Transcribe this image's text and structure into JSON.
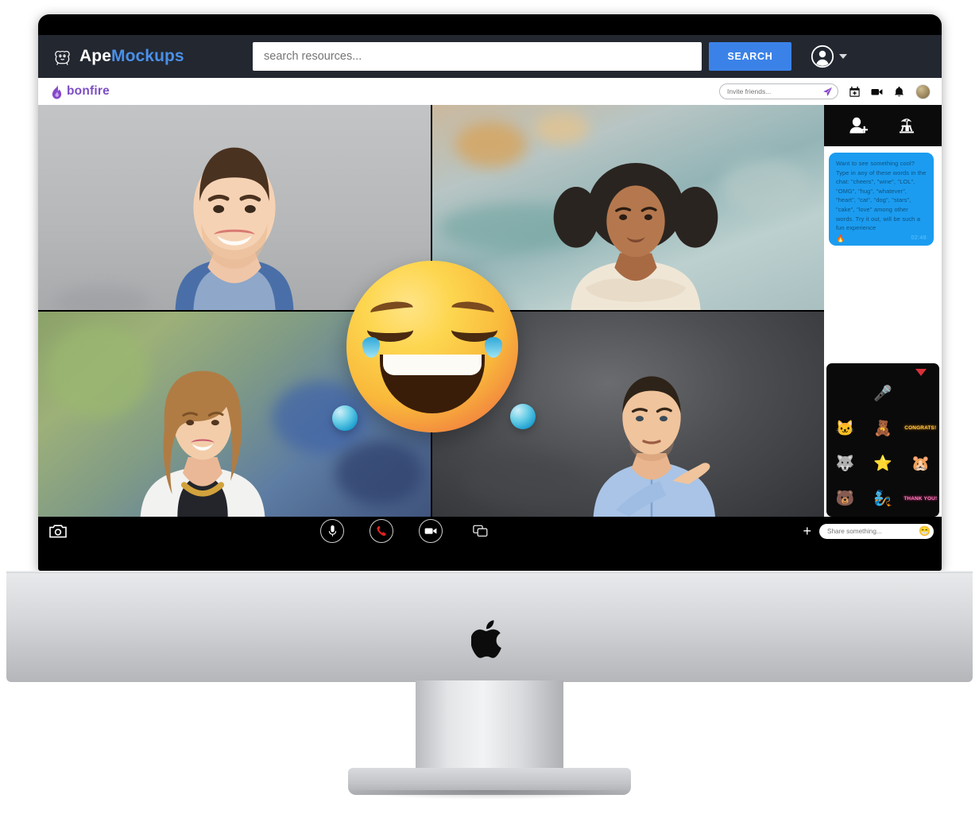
{
  "apebar": {
    "logo_text_a": "Ape",
    "logo_text_b": "Mockups",
    "logo_icon": "gorilla-icon",
    "search_placeholder": "search resources...",
    "search_value": "",
    "search_button": "SEARCH",
    "account_icon": "user-circle-icon",
    "caret_icon": "chevron-down-icon"
  },
  "appbar": {
    "brand": "bonfire",
    "brand_icon": "flame-icon",
    "invite_placeholder": "Invite friends...",
    "invite_value": "",
    "send_icon": "paper-plane-icon",
    "icons": [
      {
        "name": "calendar-add-icon"
      },
      {
        "name": "video-camera-icon"
      },
      {
        "name": "bell-icon"
      }
    ],
    "avatar": "user-avatar"
  },
  "video_grid": {
    "tiles": [
      {
        "name": "participant-tile-1",
        "description": "smiling bearded man in plaid shirt on gray backdrop"
      },
      {
        "name": "participant-tile-2",
        "description": "woman with curly hair in cream blouse, arms crossed"
      },
      {
        "name": "participant-tile-3",
        "description": "woman with long light brown hair and white blazer"
      },
      {
        "name": "participant-tile-4",
        "description": "man in light blue shirt making a shrug gesture"
      }
    ]
  },
  "emoji_overlay": {
    "name": "laughing-emoji-reaction",
    "glyph": "face-with-tears-of-joy"
  },
  "sidebar": {
    "actions": [
      {
        "name": "add-person-icon"
      },
      {
        "name": "beach-scene-icon"
      }
    ],
    "messages": [
      {
        "text": "Want to see something cool? Type in any of these words in the chat: \"cheers\", \"wine\", \"LOL\", \"OMG\", \"hug\", \"whatever\", \"heart\", \"cat\", \"dog\", \"stars\", \"cake\", \"love\" among other words. Try it out, will be such a fun experience",
        "emoji": "🔥",
        "time": "02:48"
      }
    ],
    "sticker_panel": {
      "caret_icon": "caret-down-icon",
      "stickers": [
        {
          "glyph": "🎤",
          "label": "microphone-sticker"
        },
        {
          "glyph": "🐱",
          "label": "cat-hello-sticker"
        },
        {
          "glyph": "🧸",
          "label": "bear-cake-sticker"
        },
        {
          "text": "CONGRATS!",
          "label": "congrats-sticker"
        },
        {
          "glyph": "🐺",
          "label": "dog-sticker"
        },
        {
          "glyph": "⭐",
          "label": "stars-sticker"
        },
        {
          "glyph": "🐹",
          "label": "hamster-heart-sticker"
        },
        {
          "glyph": "🐻",
          "label": "bear-hug-sticker"
        },
        {
          "glyph": "🧞",
          "label": "blue-character-sticker"
        },
        {
          "text": "THANK YOU!",
          "label": "thank-you-sticker"
        },
        {
          "glyph": "😨",
          "label": "shocked-face-sticker"
        },
        {
          "glyph": "🎈",
          "label": "balloons-sticker"
        },
        {
          "glyph": "😂",
          "label": "laughing-face-sticker"
        }
      ]
    }
  },
  "controls": {
    "snapshot_icon": "camera-icon",
    "buttons": [
      {
        "name": "microphone-button",
        "icon": "microphone-icon"
      },
      {
        "name": "hangup-button",
        "icon": "phone-icon",
        "color": "#e02020"
      },
      {
        "name": "camera-button",
        "icon": "video-camera-icon"
      },
      {
        "name": "screen-share-button",
        "icon": "screen-share-icon"
      }
    ],
    "add_label": "+",
    "share_placeholder": "Share something...",
    "share_value": "",
    "share_emoji": "😁"
  },
  "device": {
    "brand_logo": "apple-logo"
  },
  "colors": {
    "topbar_bg": "#232730",
    "search_accent": "#3b82e8",
    "brand_purple": "#7c4dc4",
    "chat_bubble": "#1b9cf0",
    "hangup_red": "#e02020"
  }
}
